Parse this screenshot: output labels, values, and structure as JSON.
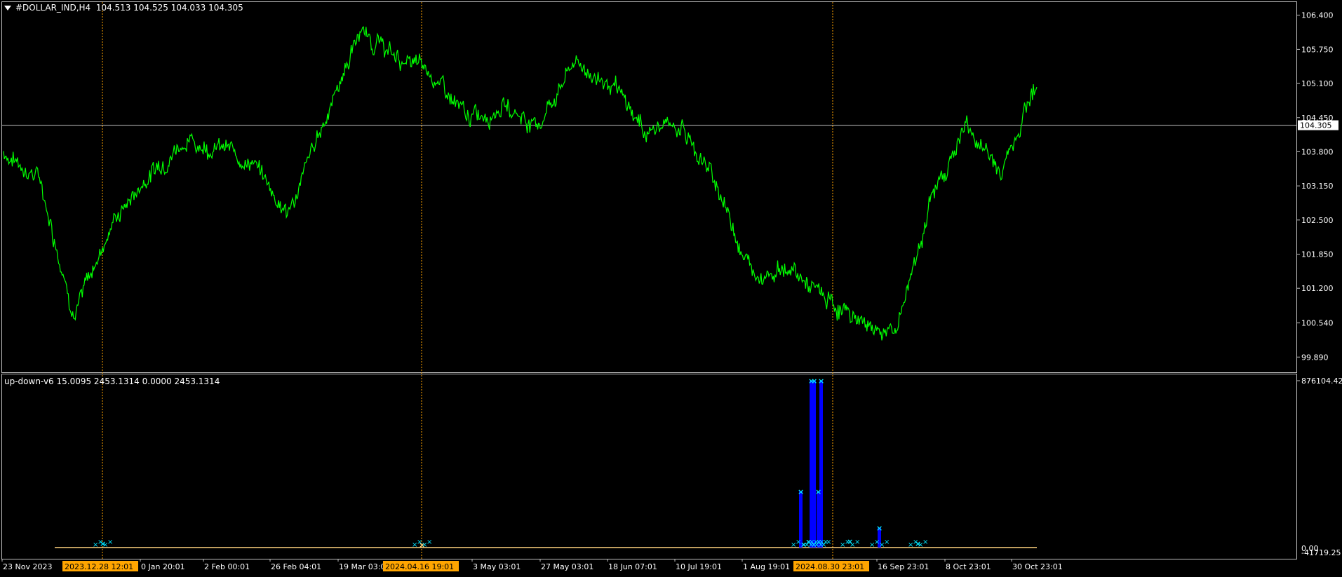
{
  "main_chart": {
    "symbol_header": "#DOLLAR_IND,H4",
    "ohlc_header": "104.513 104.525 104.033 104.305",
    "current_price_label": "104.305",
    "price_axis_labels": [
      "106.400",
      "105.750",
      "105.100",
      "104.450",
      "103.800",
      "103.150",
      "102.500",
      "101.850",
      "101.200",
      "100.540",
      "99.890"
    ],
    "price_range": [
      99.6,
      106.65
    ],
    "current_price": 104.305,
    "colors": {
      "price_line": "#00ff00",
      "background": "#000000",
      "grid_border": "#c0c0c0",
      "separator": "#ffa500"
    }
  },
  "indicator": {
    "header": "up-down-v6 15.0095 2453.1314 0.0000 2453.1314",
    "axis_top_label": "876104.42",
    "axis_bottom_label": "0.00",
    "axis_overlap_label": "-41719.25",
    "colors": {
      "bars": "#0000ff",
      "markers": "#00e5ff",
      "baseline": "#ffd27f"
    }
  },
  "time_axis": {
    "labels": [
      "23 Nov 2023",
      "0 Jan 20:01",
      "2 Feb 00:01",
      "26 Feb 04:01",
      "19 Mar 03:0",
      "3 May 03:01",
      "27 May 03:01",
      "18 Jun 07:01",
      "10 Jul 19:01",
      "1 Aug 19:01",
      "16 Sep 23:01",
      "8 Oct 23:01",
      "30 Oct 23:01"
    ],
    "highlighted": [
      "2023.12.28 12:01",
      "2024.04.16 19:01",
      "2024.08.30 23:01"
    ],
    "highlight_color": "#ffa500"
  },
  "chart_data": [
    {
      "type": "line",
      "title": "#DOLLAR_IND,H4",
      "series": [
        {
          "name": "#DOLLAR_IND",
          "x": [
            "23 Nov 2023",
            "10 Dec 2023",
            "28 Dec 2023",
            "12 Jan 2024",
            "2 Feb 2024",
            "13 Feb 2024",
            "26 Feb 2024",
            "10 Mar 2024",
            "19 Mar 2024",
            "1 Apr 2024",
            "16 Apr 2024",
            "30 Apr 2024",
            "3 May 2024",
            "16 May 2024",
            "27 May 2024",
            "10 Jun 2024",
            "18 Jun 2024",
            "1 Jul 2024",
            "10 Jul 2024",
            "20 Jul 2024",
            "1 Aug 2024",
            "12 Aug 2024",
            "30 Aug 2024",
            "10 Sep 2024",
            "16 Sep 2024",
            "27 Sep 2024",
            "8 Oct 2024",
            "20 Oct 2024",
            "30 Oct 2024",
            "2 Nov 2024"
          ],
          "values": [
            103.8,
            103.3,
            100.7,
            102.4,
            103.3,
            104.0,
            103.9,
            103.6,
            102.6,
            104.4,
            106.1,
            105.6,
            105.3,
            104.4,
            104.7,
            104.3,
            105.5,
            105.1,
            104.2,
            104.3,
            103.2,
            101.5,
            101.6,
            101.0,
            100.6,
            100.3,
            102.8,
            104.3,
            103.4,
            105.2
          ],
          "color": "#00ff00"
        }
      ],
      "y_axis_ticks": [
        106.4,
        105.75,
        105.1,
        104.45,
        103.8,
        103.15,
        102.5,
        101.85,
        101.2,
        100.54,
        99.89
      ],
      "ylim": [
        99.6,
        106.65
      ],
      "grid": false
    },
    {
      "type": "bar",
      "title": "up-down-v6",
      "series": [
        {
          "name": "up-down-v6",
          "x": [
            "28 Dec 2023",
            "16 Apr 2024",
            "24 Aug 2024",
            "25 Aug 2024",
            "26 Aug 2024",
            "27 Aug 2024",
            "28 Aug 2024",
            "12 Sep 2024",
            "16 Sep 2024",
            "20 Sep 2024"
          ],
          "values": [
            30000,
            0,
            300000,
            876104.42,
            876104.42,
            300000,
            876104.42,
            40000,
            110000,
            30000
          ],
          "color": "#0000ff"
        }
      ],
      "ylim": [
        -41719.25,
        876104.42
      ],
      "grid": false
    }
  ]
}
